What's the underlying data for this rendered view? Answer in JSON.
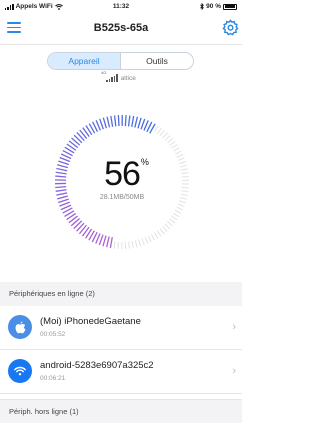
{
  "status_bar": {
    "carrier": "Appels WiFi",
    "time": "11:32",
    "battery": "90 %"
  },
  "header": {
    "title": "B525s-65a"
  },
  "tabs": [
    {
      "label": "Appareil",
      "active": true
    },
    {
      "label": "Outils",
      "active": false
    }
  ],
  "network": {
    "signal_type": "4G",
    "operator": "altice"
  },
  "gauge": {
    "percent": "56",
    "percent_sign": "%",
    "usage": "28.1MB/50MB",
    "fraction": 0.56
  },
  "online_section": {
    "label": "Périphériques en ligne (2)"
  },
  "devices": [
    {
      "name": "(Moi) iPhonedeGaetane",
      "time": "00:05:52",
      "icon": "apple-icon"
    },
    {
      "name": "android-5283e6907a325c2",
      "time": "00:06:21",
      "icon": "wifi-icon"
    }
  ],
  "offline_section": {
    "label": "Périph. hors ligne (1)"
  },
  "colors": {
    "accent": "#2d88e0",
    "gauge_start": "#3f6fe0",
    "gauge_end": "#b45ed6",
    "gauge_track": "#e2e2e2"
  }
}
